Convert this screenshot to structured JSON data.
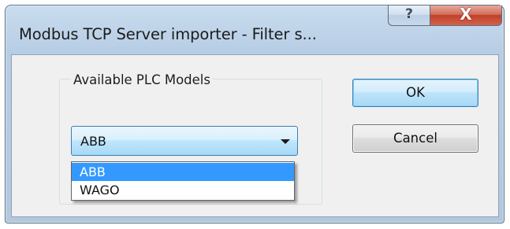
{
  "window": {
    "title": "Modbus TCP Server importer - Filter s...",
    "help_glyph": "?",
    "close_glyph": "X"
  },
  "group": {
    "label": "Available PLC Models"
  },
  "combo": {
    "selected_value": "ABB",
    "options": [
      "ABB",
      "WAGO"
    ],
    "highlighted_option": "ABB"
  },
  "buttons": {
    "ok_label": "OK",
    "cancel_label": "Cancel"
  },
  "icons": {
    "help": "question-mark-icon",
    "close": "close-icon",
    "dropdown": "chevron-down-icon"
  },
  "colors": {
    "selection_highlight": "#3399ff",
    "close_button": "#c0412a",
    "focus_border": "#3c7fb1"
  }
}
